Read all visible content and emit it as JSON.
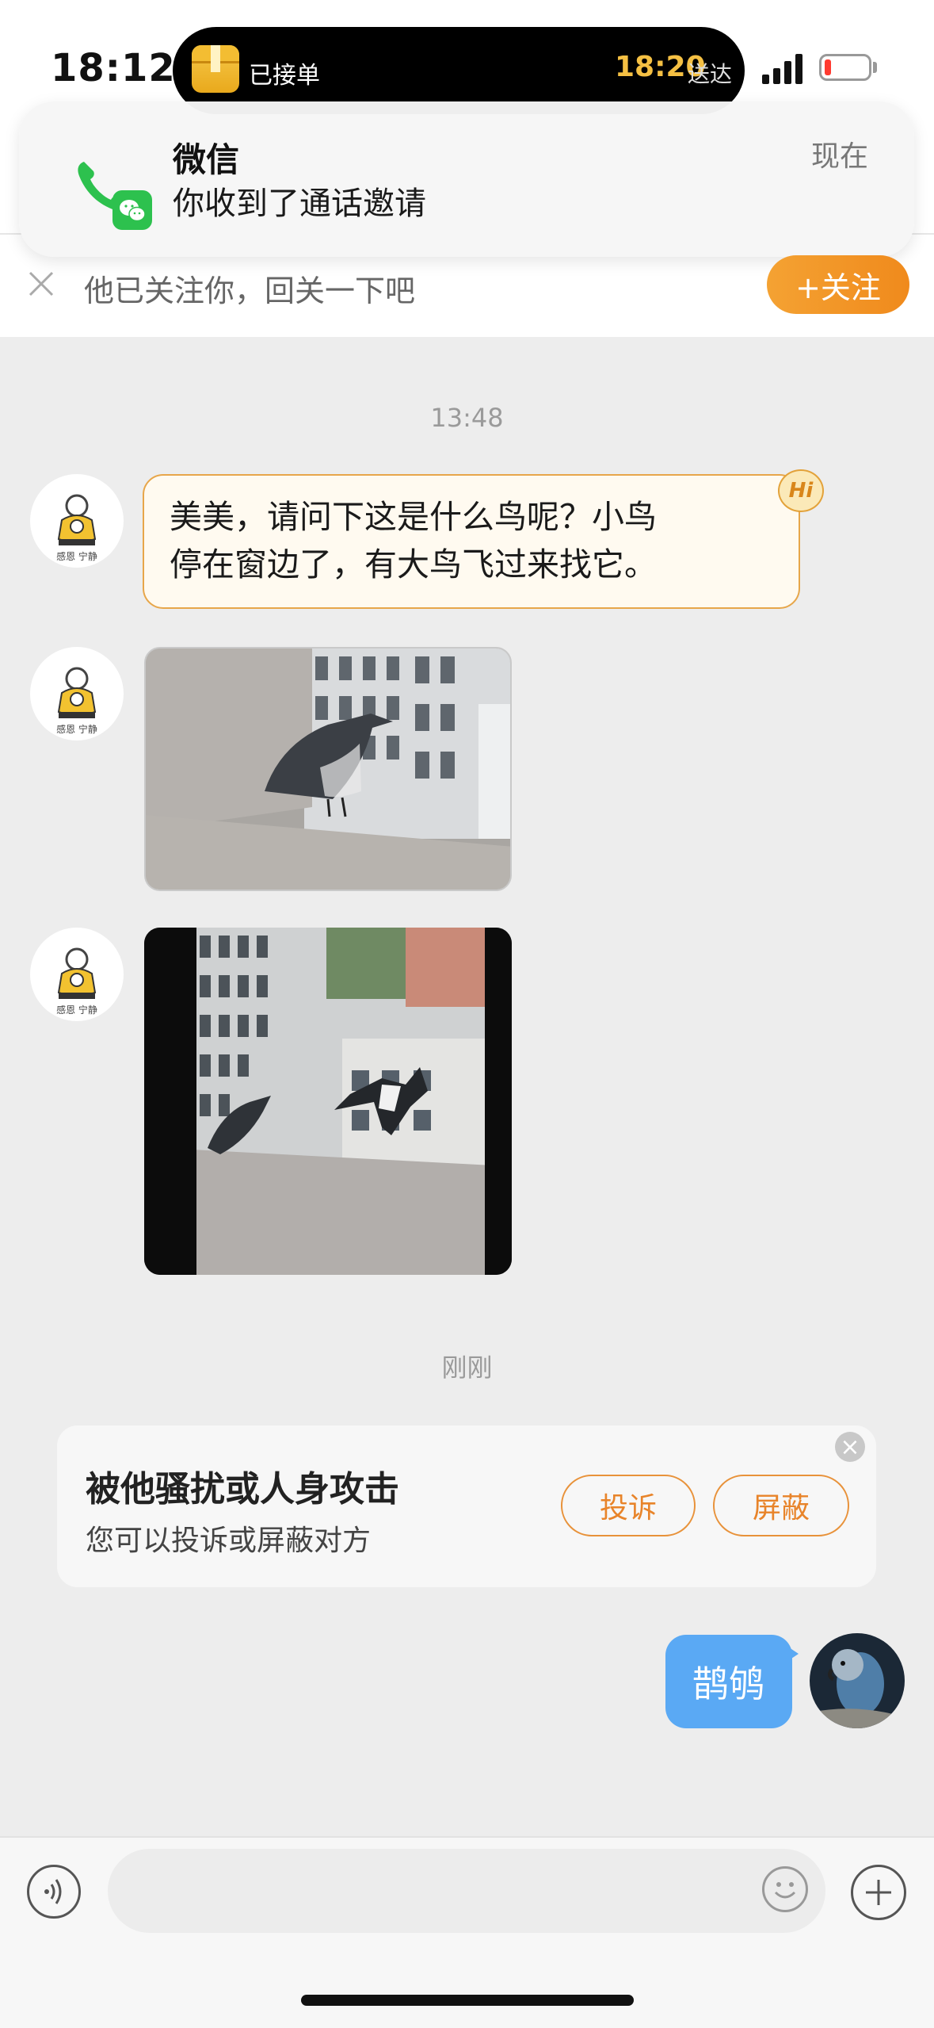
{
  "status_bar": {
    "time": "18:12",
    "live_activity": {
      "label": "已接单",
      "eta_time": "18:20",
      "eta_label": "送达"
    }
  },
  "notification": {
    "app": "微信",
    "body": "你收到了通话邀请",
    "time": "现在"
  },
  "follow_bar": {
    "text": "他已关注你，回关一下吧",
    "button_label": "+关注"
  },
  "chat": {
    "timestamp_1": "13:48",
    "messages": [
      {
        "type": "text",
        "text_line1": "美美，请问下这是什么鸟呢？小鸟",
        "text_line2": "停在窗边了，有大鸟飞过来找它。",
        "badge": "Hi"
      }
    ],
    "timestamp_2": "刚刚",
    "report_card": {
      "title": "被他骚扰或人身攻击",
      "subtitle": "您可以投诉或屏蔽对方",
      "complain_label": "投诉",
      "block_label": "屏蔽"
    },
    "my_message": "鹊鸲"
  },
  "input": {
    "placeholder": ""
  },
  "colors": {
    "accent_orange": "#f08a1c",
    "my_bubble": "#5aa9f4",
    "chat_background": "#ededed"
  }
}
